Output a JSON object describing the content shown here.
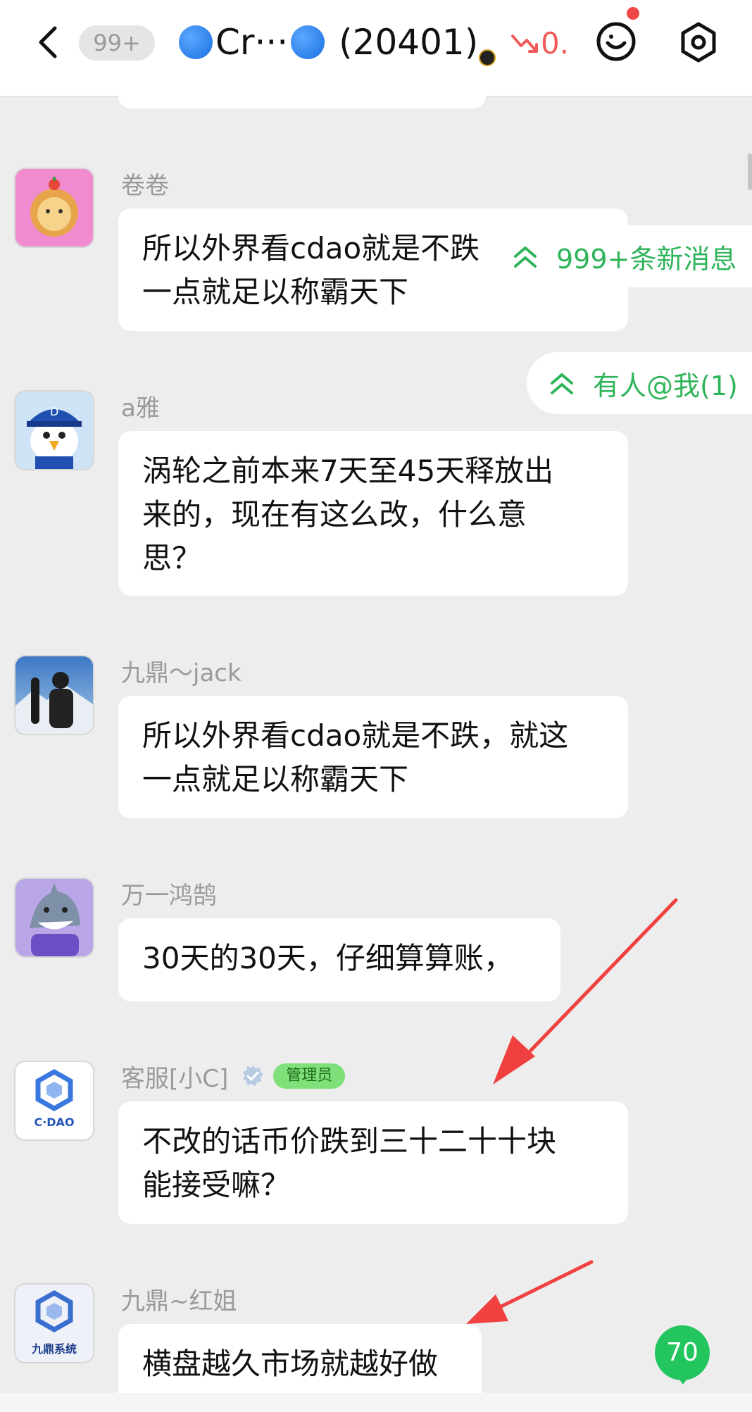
{
  "header": {
    "unread_count": "99+",
    "title_text": "Cr···",
    "member_count": "(20401)",
    "price_change": "0."
  },
  "floating": {
    "new_messages": "999+条新消息",
    "mentions": "有人@我(1)"
  },
  "messages": [
    {
      "sender": "卷卷",
      "text_line1": "所以外界看cdao就是不跌",
      "text_line2": "一点就足以称霸天下"
    },
    {
      "sender": "a雅",
      "text_line1": "涡轮之前本来7天至45天释放出",
      "text_line2": "来的，现在有这么改，什么意",
      "text_line3": "思？"
    },
    {
      "sender": "九鼎～jack",
      "text_line1": "所以外界看cdao就是不跌，就这",
      "text_line2": "一点就足以称霸天下"
    },
    {
      "sender": "万一鸿鹄",
      "text_line1": "30天的30天，仔细算算账，"
    },
    {
      "sender": "客服[小C]",
      "badge": "管理员",
      "avatar_text": "C·DAO",
      "text_line1": "不改的话币价跌到三十二十十块",
      "text_line2": "能接受嘛？"
    },
    {
      "sender": "九鼎~红姐",
      "avatar_text": "九鼎系统",
      "text_line1": "横盘越久市场就越好做"
    }
  ],
  "bottom_badge": "70",
  "colors": {
    "accent_green": "#2fb45a",
    "badge_green": "#22c55e",
    "price_red": "#f05a5a",
    "annotation_red": "#f04040",
    "chat_background": "#ededed"
  }
}
